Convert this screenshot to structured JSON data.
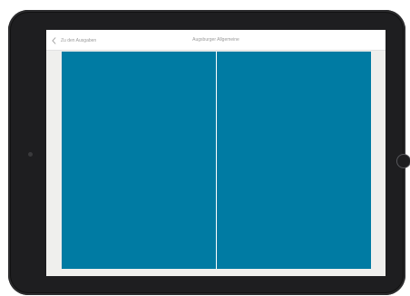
{
  "app": {
    "back_label": "Zu den Ausgaben",
    "title": "Augsburger Allgemeine"
  },
  "viewer": {
    "page_color": "#007ba3",
    "pages": [
      "left",
      "right"
    ]
  }
}
